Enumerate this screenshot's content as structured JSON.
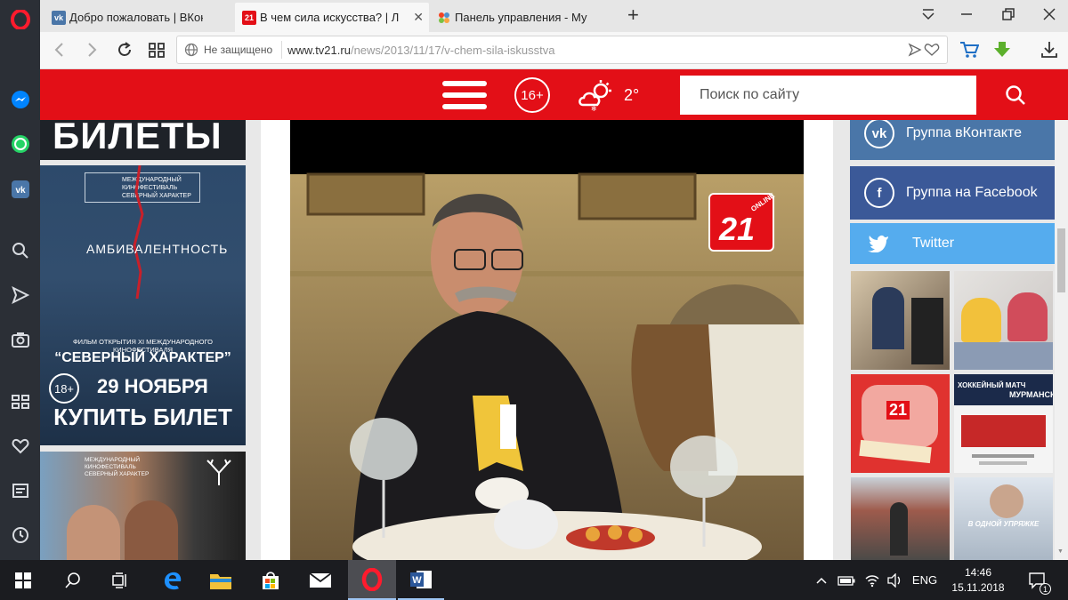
{
  "tabs": [
    {
      "label": "Добро пожаловать | ВКонтакте",
      "favicon": "vk-icon",
      "active": false
    },
    {
      "label": "В чем сила искусства? | Л",
      "favicon": "tv21-icon",
      "active": true
    },
    {
      "label": "Панель управления - Му",
      "favicon": "joomla-icon",
      "active": false
    }
  ],
  "address": {
    "security_label": "Не защищено",
    "url_host": "www.tv21.ru",
    "url_path": "/news/2013/11/17/v-chem-sila-iskusstva"
  },
  "site_header": {
    "age_rating": "16+",
    "temperature": "2°",
    "search_placeholder": "Поиск по сайту"
  },
  "left_ads": {
    "ad1_text": "БИЛЕТЫ",
    "ad2": {
      "festival_line1": "МЕЖДУНАРОДНЫЙ",
      "festival_line2": "КИНОФЕСТИВАЛЬ",
      "festival_line3": "СЕВЕРНЫЙ ХАРАКТЕР",
      "film_title": "АМБИВАЛЕНТНОСТЬ",
      "opening_line": "ФИЛЬМ ОТКРЫТИЯ XI МЕЖДУНАРОДНОГО КИНОФЕСТИВАЛЯ",
      "festival_name": "“СЕВЕРНЫЙ ХАРАКТЕР”",
      "age": "18+",
      "date": "29 НОЯБРЯ",
      "cta": "КУПИТЬ БИЛЕТ"
    },
    "ad3": {
      "festival_line1": "МЕЖДУНАРОДНЫЙ",
      "festival_line2": "КИНОФЕСТИВАЛЬ",
      "festival_line3": "СЕВЕРНЫЙ ХАРАКТЕР"
    }
  },
  "video": {
    "logo_top": "ONLINE",
    "logo_num": "21"
  },
  "social": [
    {
      "label": "Группа вКонтакте",
      "icon": "vk-icon",
      "color": "#4a76a8"
    },
    {
      "label": "Группа на Facebook",
      "icon": "facebook-icon",
      "color": "#3b5998"
    },
    {
      "label": "Twitter",
      "icon": "twitter-icon",
      "color": "#55acee"
    }
  ],
  "thumbs": {
    "t4_title": "ХОККЕЙНЫЙ МАТЧ",
    "t4_sub": "МУРМАНСК",
    "t6_title": "В ОДНОЙ УПРЯЖКЕ",
    "t3_logo": "21"
  },
  "taskbar": {
    "language": "ENG",
    "time": "14:46",
    "date": "15.11.2018",
    "notifications": "1"
  },
  "colors": {
    "brand_red": "#e30f17",
    "sidebar_bg": "#2b2f36",
    "taskbar_bg": "#1b1c20"
  }
}
